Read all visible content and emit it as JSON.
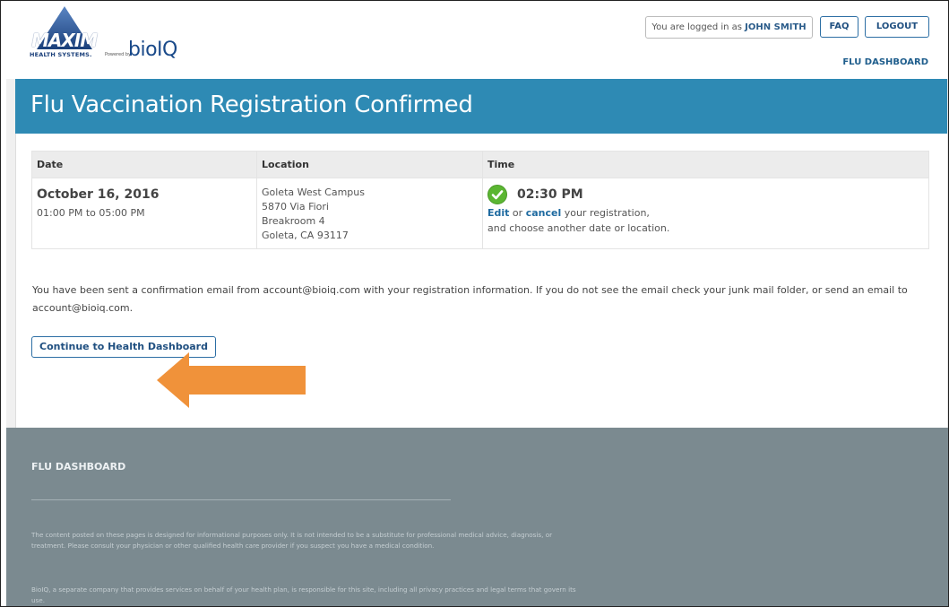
{
  "header": {
    "logo": {
      "brand": "MAXIM",
      "subtitle": "HEALTH SYSTEMS.",
      "powered_by": "Powered by",
      "partner": "bioIQ"
    },
    "login_prefix": "You are logged in as",
    "user_name": "JOHN SMITH",
    "faq_label": "FAQ",
    "logout_label": "LOGOUT",
    "flu_dashboard_link": "FLU DASHBOARD"
  },
  "page_title": "Flu Vaccination Registration Confirmed",
  "table": {
    "headers": [
      "Date",
      "Location",
      "Time"
    ],
    "date": "October 16, 2016",
    "date_hours": "01:00 PM to 05:00 PM",
    "location_lines": [
      "Goleta West Campus",
      "5870 Via Fiori",
      "Breakroom 4",
      "Goleta, CA 93117"
    ],
    "time": "02:30 PM",
    "edit_label": "Edit",
    "or_text": "or",
    "cancel_label": "cancel",
    "note_line1_suffix": "your registration,",
    "note_line2": "and choose another date or location."
  },
  "confirmation_text": "You have been sent a confirmation email from account@bioiq.com with your registration information. If you do not see the email check your junk mail folder, or send an email to account@bioiq.com.",
  "continue_button": "Continue to Health Dashboard",
  "footer": {
    "title": "FLU DASHBOARD",
    "disclaimer": "The content posted on these pages is designed for informational purposes only. It is not intended to be a substitute for professional medical advice, diagnosis, or treatment. Please consult your physician or other qualified health care provider if you suspect you have a medical condition.",
    "bioiq_note": "BioIQ, a separate company that provides services on behalf of your health plan, is responsible for this site, including all privacy practices and legal terms that govern its use."
  },
  "colors": {
    "title_bar": "#2e8ab4",
    "footer_bg": "#7b8a90",
    "link": "#1e6aa0",
    "check_green": "#5bb632",
    "arrow_orange": "#f0923a"
  },
  "icons": [
    "check-circle-icon",
    "left-arrow-icon",
    "maxim-triangle-logo"
  ]
}
